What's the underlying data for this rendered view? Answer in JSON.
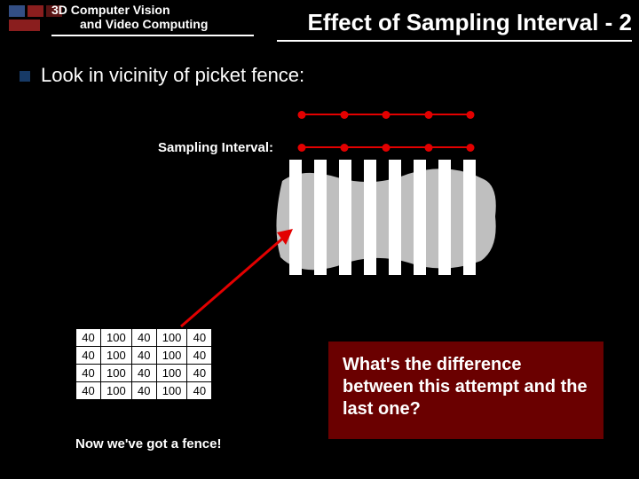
{
  "header": {
    "line1": "3D Computer Vision",
    "line2": "and Video Computing"
  },
  "title": "Effect of Sampling Interval - 2",
  "bullet": "Look in vicinity of picket fence:",
  "sampling_label": "Sampling Interval:",
  "table": {
    "rows": [
      [
        "40",
        "100",
        "40",
        "100",
        "40"
      ],
      [
        "40",
        "100",
        "40",
        "100",
        "40"
      ],
      [
        "40",
        "100",
        "40",
        "100",
        "40"
      ],
      [
        "40",
        "100",
        "40",
        "100",
        "40"
      ]
    ]
  },
  "caption": "Now we've got a fence!",
  "callout": "What's the difference between this attempt and the last one?",
  "chart_data": {
    "type": "table",
    "title": "Sampled intensity values",
    "columns": [
      "c1",
      "c2",
      "c3",
      "c4",
      "c5"
    ],
    "rows": [
      [
        40,
        100,
        40,
        100,
        40
      ],
      [
        40,
        100,
        40,
        100,
        40
      ],
      [
        40,
        100,
        40,
        100,
        40
      ],
      [
        40,
        100,
        40,
        100,
        40
      ]
    ]
  }
}
